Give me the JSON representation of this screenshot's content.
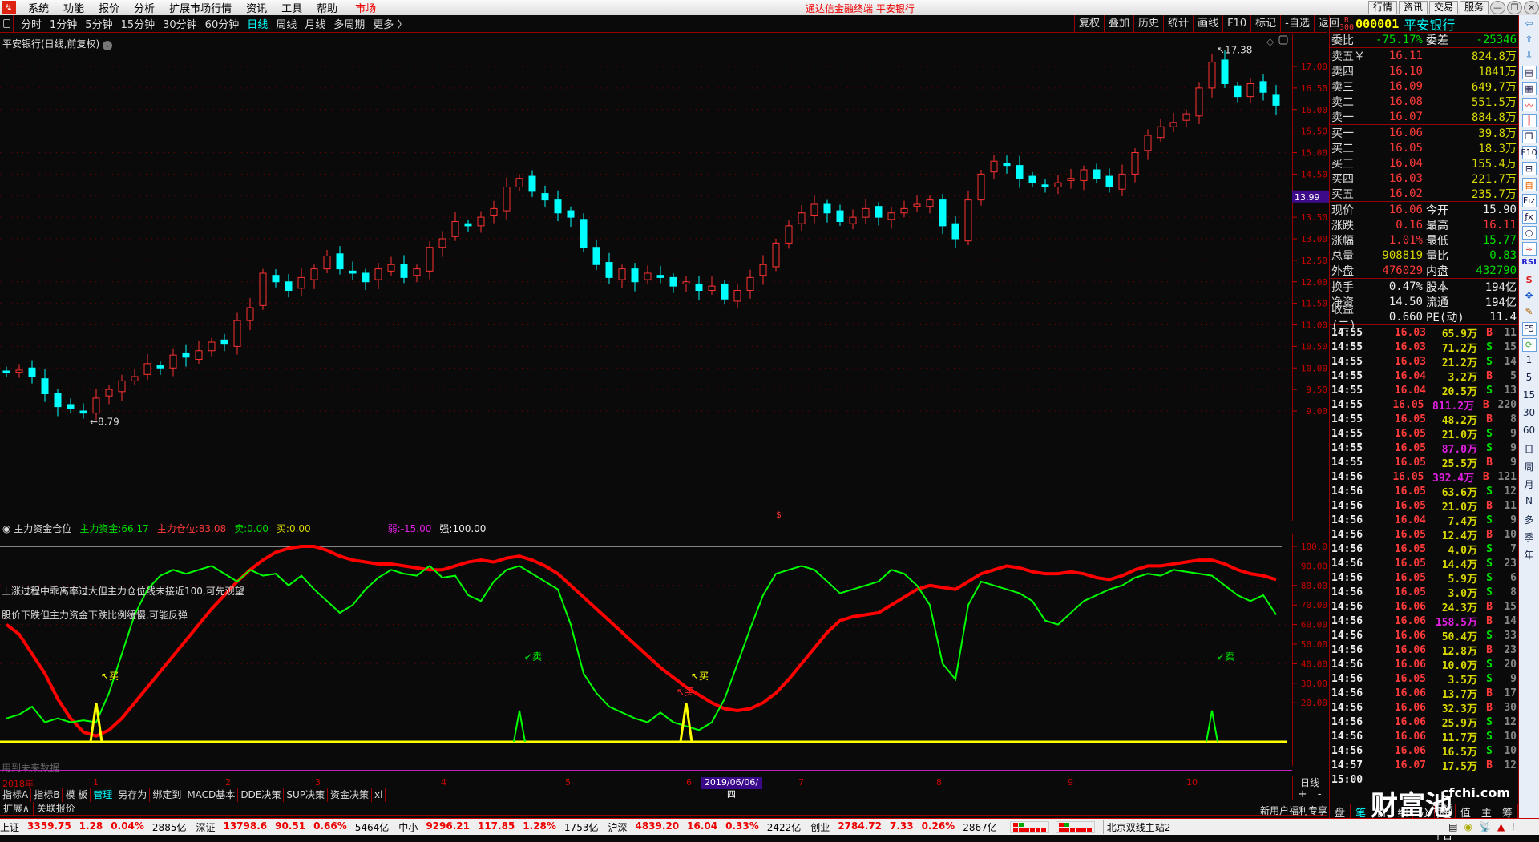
{
  "menu": {
    "items": [
      "系统",
      "功能",
      "报价",
      "分析",
      "扩展市场行情",
      "资讯",
      "工具",
      "帮助"
    ],
    "market": "市场",
    "app_title": "通达信金融终端  平安银行",
    "right_buttons": [
      "行情",
      "资讯",
      "交易",
      "服务"
    ]
  },
  "periods": {
    "items": [
      "分时",
      "1分钟",
      "5分钟",
      "15分钟",
      "30分钟",
      "60分钟",
      "日线",
      "周线",
      "月线",
      "多周期",
      "更多 〉"
    ],
    "active": "日线"
  },
  "chart_tools": [
    "复权",
    "叠加",
    "历史",
    "统计",
    "画线",
    "F10",
    "标记",
    "-自选",
    "返回"
  ],
  "chart": {
    "title": "平安银行(日线,前复权)",
    "high_label": "17.38",
    "low_label": "8.79",
    "cursor_price": "13.99",
    "marker": "$"
  },
  "indicator": {
    "name": "主力资金仓位",
    "fund_label": "主力资金:",
    "fund_value": "66.17",
    "pos_label": "主力仓位:",
    "pos_value": "83.08",
    "sell_label": "卖:",
    "sell_value": "0.00",
    "buy_label": "买:",
    "buy_value": "0.00",
    "weak_label": "弱:",
    "weak_value": "-15.00",
    "strong_label": "强:",
    "strong_value": "100.00",
    "note1": "上涨过程中乖离率过大但主力仓位线未接近100,可先观望",
    "note2": "股价下跌但主力资金下跌比例缓慢,可能反弹",
    "future_warning": "用到未来数据"
  },
  "xaxis": {
    "labels": [
      "2018年",
      "1",
      "2",
      "3",
      "4",
      "5",
      "6",
      "7",
      "8",
      "9",
      "10"
    ],
    "cursor_date": "2019/06/06/四",
    "period": "日线",
    "zoom_in": "+",
    "zoom_out": "-"
  },
  "bottom_tabs": {
    "row1": [
      "指标A",
      "指标B",
      "模 板",
      "管理",
      "另存为",
      "绑定到",
      "MACD基本",
      "DDE决策",
      "SUP决策",
      "资金决策",
      "xl"
    ],
    "active": "管理",
    "row2": [
      "扩展∧",
      "关联报价"
    ],
    "promo": "新用户福利专享"
  },
  "quote": {
    "rank_top": "R",
    "rank_num": "300",
    "code": "000001",
    "name": "平安银行",
    "weibi_label": "委比",
    "weibi": "-75.17%",
    "weicha_label": "委差",
    "weicha": "-25346",
    "asks": [
      {
        "label": "卖五￥",
        "price": "16.11",
        "vol": "824.8万"
      },
      {
        "label": "卖四",
        "price": "16.10",
        "vol": "1841万"
      },
      {
        "label": "卖三",
        "price": "16.09",
        "vol": "649.7万"
      },
      {
        "label": "卖二",
        "price": "16.08",
        "vol": "551.5万"
      },
      {
        "label": "卖一",
        "price": "16.07",
        "vol": "884.8万"
      }
    ],
    "bids": [
      {
        "label": "买一",
        "price": "16.06",
        "vol": "39.8万"
      },
      {
        "label": "买二",
        "price": "16.05",
        "vol": "18.3万"
      },
      {
        "label": "买三",
        "price": "16.04",
        "vol": "155.4万"
      },
      {
        "label": "买四",
        "price": "16.03",
        "vol": "221.7万"
      },
      {
        "label": "买五",
        "price": "16.02",
        "vol": "235.7万"
      }
    ],
    "stats": [
      {
        "l1": "现价",
        "v1": "16.06",
        "c1": "red",
        "l2": "今开",
        "v2": "15.90",
        "c2": "wht"
      },
      {
        "l1": "涨跌",
        "v1": "0.16",
        "c1": "red",
        "l2": "最高",
        "v2": "16.11",
        "c2": "red"
      },
      {
        "l1": "涨幅",
        "v1": "1.01%",
        "c1": "red",
        "l2": "最低",
        "v2": "15.77",
        "c2": "grn"
      },
      {
        "l1": "总量",
        "v1": "908819",
        "c1": "yel",
        "l2": "量比",
        "v2": "0.83",
        "c2": "grn"
      },
      {
        "l1": "外盘",
        "v1": "476029",
        "c1": "red",
        "l2": "内盘",
        "v2": "432790",
        "c2": "grn"
      }
    ],
    "fundamentals": [
      {
        "l1": "换手",
        "v1": "0.47%",
        "l2": "股本",
        "v2": "194亿"
      },
      {
        "l1": "净资",
        "v1": "14.50",
        "l2": "流通",
        "v2": "194亿"
      },
      {
        "l1": "收益(二)",
        "v1": "0.660",
        "l2": "PE(动)",
        "v2": "11.4"
      }
    ]
  },
  "ticks": [
    [
      "14:55",
      "16.03",
      "65.9万",
      "B",
      "11",
      0
    ],
    [
      "14:55",
      "16.03",
      "71.2万",
      "S",
      "15",
      0
    ],
    [
      "14:55",
      "16.03",
      "21.2万",
      "S",
      "14",
      0
    ],
    [
      "14:55",
      "16.04",
      "3.2万",
      "B",
      "5",
      0
    ],
    [
      "14:55",
      "16.04",
      "20.5万",
      "S",
      "13",
      0
    ],
    [
      "14:55",
      "16.05",
      "811.2万",
      "B",
      "220",
      1
    ],
    [
      "14:55",
      "16.05",
      "48.2万",
      "B",
      "8",
      0
    ],
    [
      "14:55",
      "16.05",
      "21.0万",
      "S",
      "9",
      0
    ],
    [
      "14:55",
      "16.05",
      "87.0万",
      "S",
      "9",
      1
    ],
    [
      "14:55",
      "16.05",
      "25.5万",
      "B",
      "9",
      0
    ],
    [
      "14:56",
      "16.05",
      "392.4万",
      "B",
      "121",
      1
    ],
    [
      "14:56",
      "16.05",
      "63.6万",
      "S",
      "12",
      0
    ],
    [
      "14:56",
      "16.05",
      "21.0万",
      "B",
      "11",
      0
    ],
    [
      "14:56",
      "16.04",
      "7.4万",
      "S",
      "9",
      0
    ],
    [
      "14:56",
      "16.05",
      "12.4万",
      "B",
      "10",
      0
    ],
    [
      "14:56",
      "16.05",
      "4.0万",
      "S",
      "7",
      0
    ],
    [
      "14:56",
      "16.05",
      "14.4万",
      "S",
      "23",
      0
    ],
    [
      "14:56",
      "16.05",
      "5.9万",
      "S",
      "6",
      0
    ],
    [
      "14:56",
      "16.05",
      "3.0万",
      "S",
      "8",
      0
    ],
    [
      "14:56",
      "16.06",
      "24.3万",
      "B",
      "15",
      0
    ],
    [
      "14:56",
      "16.06",
      "158.5万",
      "B",
      "14",
      1
    ],
    [
      "14:56",
      "16.06",
      "50.4万",
      "S",
      "33",
      0
    ],
    [
      "14:56",
      "16.06",
      "12.8万",
      "B",
      "23",
      0
    ],
    [
      "14:56",
      "16.06",
      "10.0万",
      "S",
      "20",
      0
    ],
    [
      "14:56",
      "16.05",
      "3.5万",
      "S",
      "9",
      0
    ],
    [
      "14:56",
      "16.06",
      "13.7万",
      "B",
      "17",
      0
    ],
    [
      "14:56",
      "16.06",
      "32.3万",
      "B",
      "30",
      0
    ],
    [
      "14:56",
      "16.06",
      "25.9万",
      "S",
      "12",
      0
    ],
    [
      "14:56",
      "16.06",
      "11.7万",
      "S",
      "10",
      0
    ],
    [
      "14:56",
      "16.06",
      "16.5万",
      "S",
      "10",
      0
    ],
    [
      "14:57",
      "16.07",
      "17.5万",
      "B",
      "12",
      0
    ],
    [
      "15:00",
      "",
      "",
      "",
      "",
      0
    ]
  ],
  "quote_tabs": [
    "盘",
    "笔",
    "价",
    "细",
    "分",
    "联",
    "值",
    "主",
    "筹"
  ],
  "quote_tabs_active": "笔",
  "watermark": {
    "big": "财富池",
    "site": "cfchi.com",
    "sub": "指标交易平台"
  },
  "side_periods": [
    "1",
    "5",
    "15",
    "30",
    "60",
    "日",
    "周",
    "月",
    "N",
    "多",
    "季",
    "年"
  ],
  "side_icons": [
    "F10",
    "RSI",
    "F5",
    "$"
  ],
  "statusbar": {
    "indices": [
      {
        "name": "上证",
        "price": "3359.75",
        "chg": "1.28",
        "pct": "0.04%",
        "amt": "2885亿"
      },
      {
        "name": "深证",
        "price": "13798.6",
        "chg": "90.51",
        "pct": "0.66%",
        "amt": "5464亿"
      },
      {
        "name": "中小",
        "price": "9296.21",
        "chg": "117.85",
        "pct": "1.28%",
        "amt": "1753亿"
      },
      {
        "name": "沪深",
        "price": "4839.20",
        "chg": "16.04",
        "pct": "0.33%",
        "amt": "2422亿"
      },
      {
        "name": "创业",
        "price": "2784.72",
        "chg": "7.33",
        "pct": "0.26%",
        "amt": "2867亿"
      }
    ],
    "server": "北京双线主站2"
  },
  "colors": {
    "up": "#ff3232",
    "down": "#00ffff",
    "axis": "#cc0000",
    "fund_line": "#00ff00",
    "position_line": "#ff0000",
    "signal": "#ffff00"
  },
  "chart_data": [
    {
      "type": "candlestick",
      "title": "平安银行(日线,前复权)",
      "ylim": [
        8.6,
        17.6
      ],
      "yticks": [
        9,
        9.5,
        10,
        10.5,
        11,
        11.5,
        12,
        12.5,
        13,
        13.5,
        14,
        14.5,
        15,
        15.5,
        16,
        16.5,
        17
      ],
      "closes": [
        9.9,
        9.95,
        9.8,
        9.4,
        9.1,
        9.05,
        8.95,
        9.3,
        9.5,
        9.7,
        9.8,
        10.1,
        10.0,
        10.3,
        10.25,
        10.4,
        10.6,
        10.55,
        11.1,
        11.4,
        12.2,
        12.0,
        11.8,
        12.1,
        12.3,
        12.6,
        12.3,
        12.2,
        12.0,
        12.3,
        12.4,
        12.1,
        12.3,
        12.8,
        13.0,
        13.4,
        13.3,
        13.5,
        13.7,
        14.2,
        14.4,
        14.1,
        13.9,
        13.6,
        13.5,
        12.8,
        12.4,
        12.1,
        12.3,
        12.0,
        12.2,
        12.1,
        11.9,
        12.0,
        11.8,
        11.9,
        11.6,
        11.8,
        12.1,
        12.4,
        12.9,
        13.3,
        13.6,
        13.8,
        13.6,
        13.4,
        13.5,
        13.7,
        13.5,
        13.6,
        13.7,
        13.8,
        13.9,
        13.3,
        13.0,
        13.9,
        14.5,
        14.8,
        14.7,
        14.4,
        14.3,
        14.2,
        14.3,
        14.4,
        14.6,
        14.4,
        14.2,
        14.5,
        15.0,
        15.4,
        15.6,
        15.7,
        15.9,
        16.5,
        17.1,
        16.6,
        16.3,
        16.6,
        16.4,
        16.1
      ],
      "high": 17.38,
      "low": 8.79
    },
    {
      "type": "line",
      "title": "主力资金仓位",
      "ylim": [
        0,
        100
      ],
      "yticks": [
        20,
        30,
        40,
        50,
        60,
        70,
        80,
        90,
        100
      ],
      "series": [
        {
          "name": "主力仓位",
          "values": [
            60,
            55,
            45,
            35,
            22,
            12,
            5,
            3,
            6,
            12,
            20,
            28,
            36,
            44,
            52,
            60,
            68,
            75,
            82,
            88,
            93,
            97,
            99,
            100,
            100,
            98,
            95,
            93,
            92,
            91,
            91,
            90,
            89,
            88,
            88,
            90,
            92,
            93,
            92,
            94,
            95,
            93,
            90,
            86,
            80,
            74,
            68,
            62,
            56,
            50,
            44,
            38,
            33,
            28,
            24,
            20,
            17,
            16,
            17,
            20,
            25,
            32,
            40,
            48,
            56,
            62,
            64,
            65,
            66,
            70,
            74,
            78,
            80,
            79,
            78,
            82,
            86,
            88,
            90,
            89,
            87,
            86,
            86,
            87,
            86,
            84,
            83,
            85,
            88,
            90,
            90,
            91,
            92,
            93,
            93,
            91,
            88,
            86,
            85,
            83
          ]
        },
        {
          "name": "主力资金",
          "values": [
            12,
            14,
            18,
            10,
            12,
            10,
            11,
            10,
            25,
            45,
            65,
            78,
            85,
            88,
            86,
            88,
            90,
            86,
            82,
            88,
            85,
            86,
            80,
            85,
            78,
            72,
            66,
            70,
            78,
            84,
            88,
            86,
            85,
            90,
            84,
            85,
            75,
            72,
            82,
            88,
            90,
            86,
            82,
            78,
            60,
            35,
            25,
            18,
            15,
            12,
            10,
            15,
            10,
            8,
            6,
            10,
            22,
            40,
            58,
            75,
            86,
            88,
            90,
            88,
            82,
            76,
            78,
            80,
            82,
            88,
            86,
            80,
            70,
            40,
            32,
            70,
            82,
            80,
            78,
            76,
            72,
            62,
            60,
            66,
            72,
            75,
            78,
            80,
            84,
            86,
            85,
            88,
            87,
            86,
            85,
            80,
            75,
            72,
            75,
            65
          ]
        }
      ],
      "signals": [
        {
          "bar": 7,
          "type": "buy",
          "label": "↖买"
        },
        {
          "bar": 40,
          "type": "sell",
          "label": "↙卖"
        },
        {
          "bar": 53,
          "type": "buy",
          "label": "↖买"
        },
        {
          "bar": 94,
          "type": "sell",
          "label": "↙卖"
        }
      ],
      "extra_labels": [
        {
          "bar": 52,
          "label": "↖买",
          "color": "red"
        }
      ],
      "baseline": 0,
      "top_line": 100
    }
  ]
}
